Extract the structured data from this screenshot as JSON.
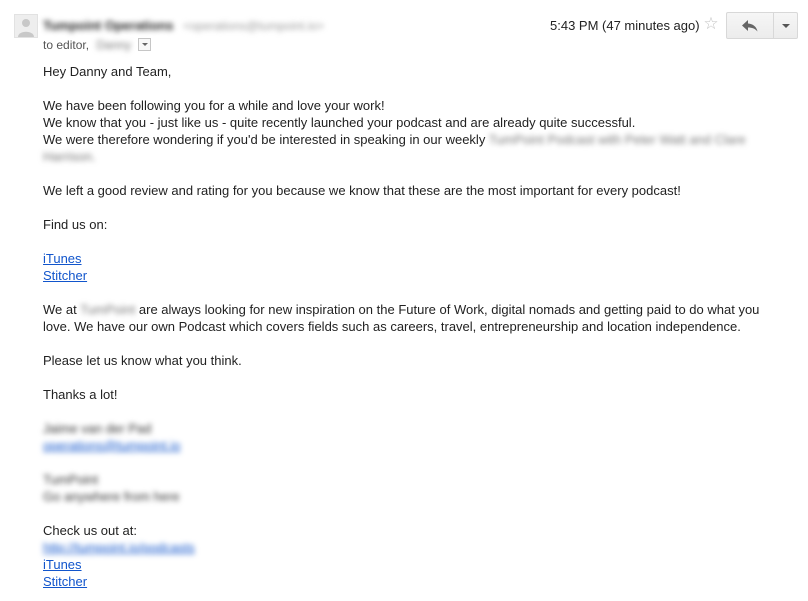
{
  "header": {
    "sender_name": "Tumpoint Operations",
    "sender_email": "<operations@tumpoint.io>",
    "to_prefix": "to editor,",
    "to_recipient": "Danny",
    "timestamp": "5:43 PM (47 minutes ago)"
  },
  "icons": {
    "avatar": "person-icon",
    "star": "star-icon",
    "reply": "reply-icon",
    "more": "chevron-down-icon"
  },
  "message": {
    "greeting": "Hey Danny and Team,",
    "para1_line1": "We have been following you for a while and love your work!",
    "para1_line2": "We know that you - just like us - quite recently launched your podcast and are already quite successful.",
    "para1_line3_prefix": "We were therefore wondering if you'd be interested in speaking in our weekly",
    "para1_line3_blur": "TumPoint Podcast with Peter Watt and Clare",
    "para1_line4_blur": "Harrison.",
    "review_line": "We left a good review and rating for you because we know that these are the most important for every podcast!",
    "find_us": "Find us on:",
    "link_itunes": "iTunes",
    "link_stitcher": "Stitcher",
    "about_prefix": "We at",
    "about_blur": "TumPoint",
    "about_line1_rest": "are always looking for new inspiration on the Future of Work, digital nomads and getting paid to do what you",
    "about_line2": "love. We have our own Podcast which covers fields such as careers, travel, entrepreneurship and location independence.",
    "ask": "Please let us know what you think.",
    "thanks": "Thanks a lot!",
    "sig_name": "Jaime van der Pad",
    "sig_email": "operations@tumpoint.io",
    "company_name": "TumPoint",
    "company_tagline": "Go anywhere from here",
    "check_out": "Check us out at:",
    "check_link_blur": "http://tumpoint.io/podcasts",
    "check_itunes": "iTunes",
    "check_stitcher": "Stitcher"
  },
  "colors": {
    "link": "#1155cc",
    "text": "#222222",
    "star": "#c4c4c4"
  }
}
